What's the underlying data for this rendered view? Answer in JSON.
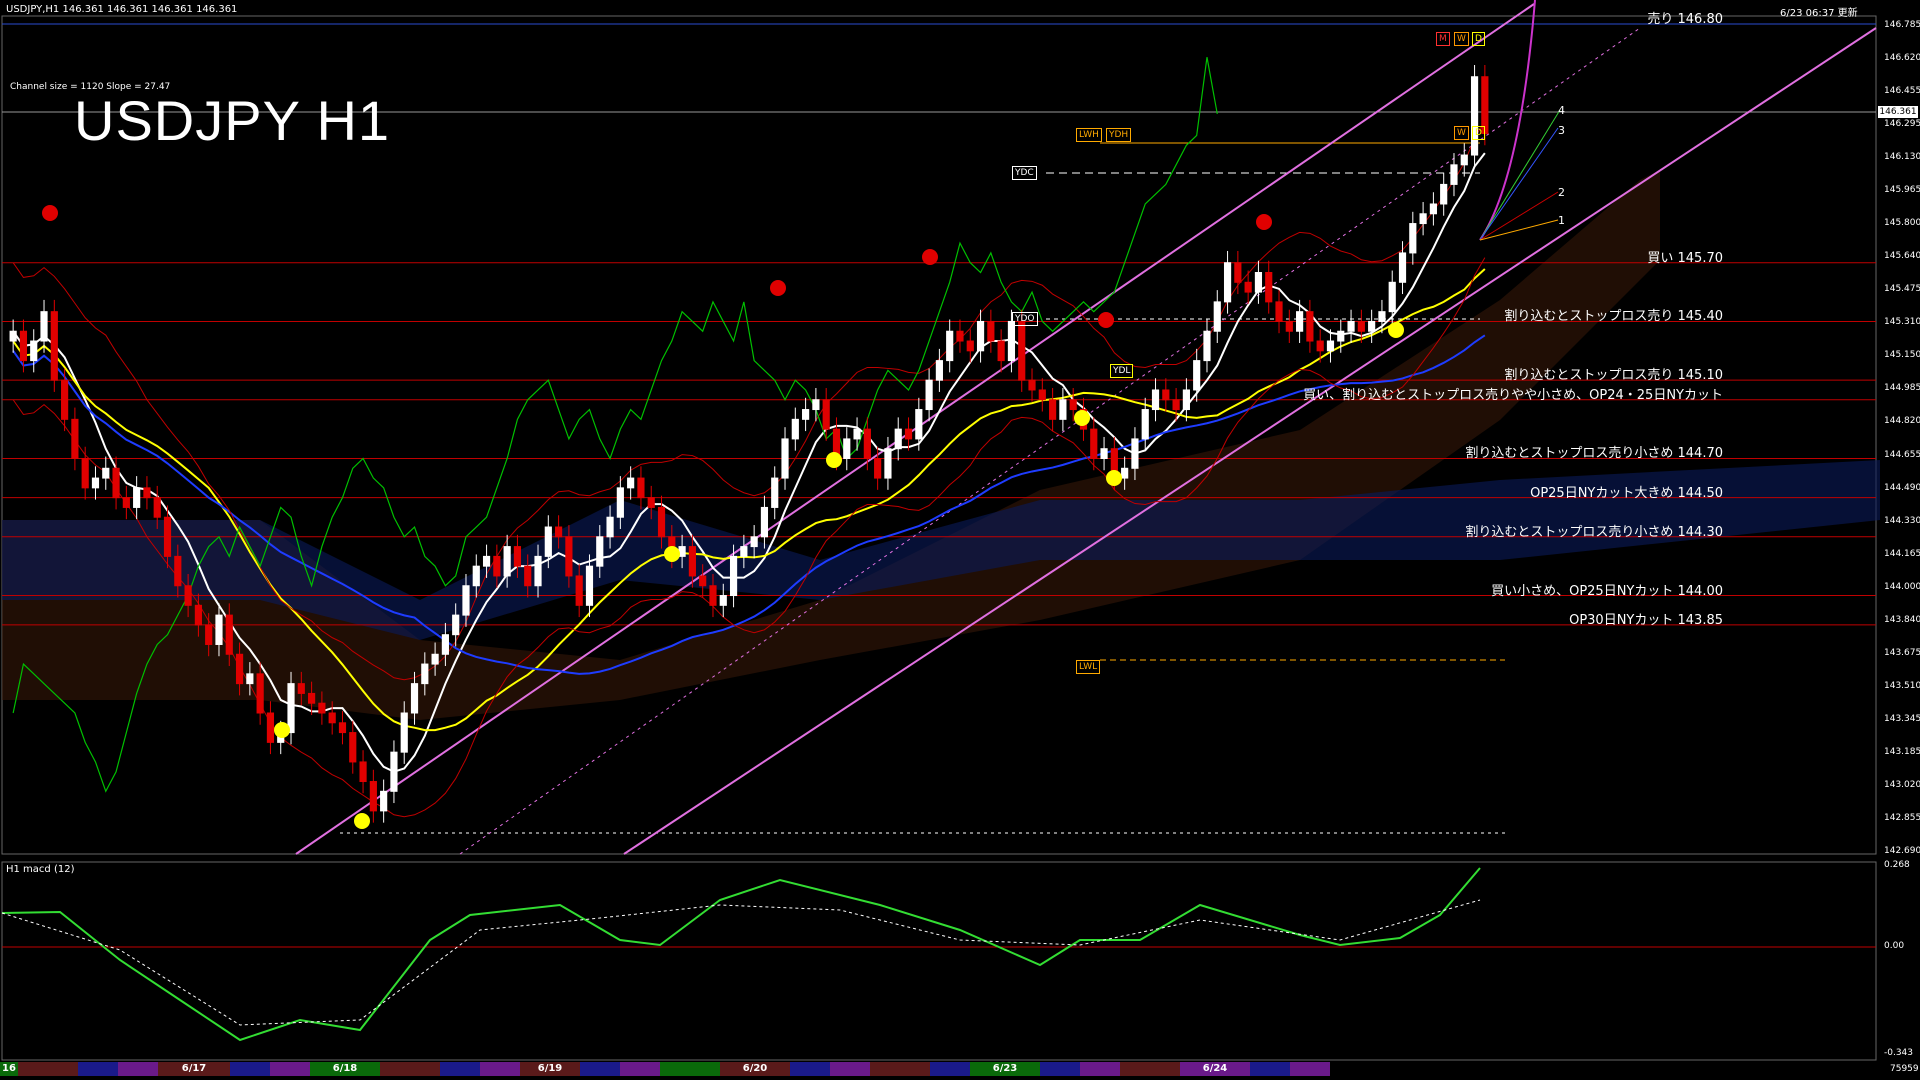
{
  "header": {
    "symbol_line": "USDJPY,H1  146.361 146.361 146.361 146.361",
    "datetime": "6/23 06:37 更新",
    "channel_info": "Channel size = 1120 Slope = 27.47",
    "big_title": "USDJPY H1"
  },
  "sub_chart": {
    "label": "H1  macd (12)",
    "axis": [
      "0.268",
      "0.00",
      "-0.343"
    ],
    "bottom_right": "75959"
  },
  "current_price": "146.361",
  "price_axis": [
    "146.785",
    "146.620",
    "146.455",
    "146.295",
    "146.130",
    "145.965",
    "145.800",
    "145.640",
    "145.475",
    "145.310",
    "145.150",
    "144.985",
    "144.820",
    "144.655",
    "144.490",
    "144.330",
    "144.165",
    "144.000",
    "143.840",
    "143.675",
    "143.510",
    "143.345",
    "143.185",
    "143.020",
    "142.855",
    "142.690"
  ],
  "levels": [
    {
      "price": 146.8,
      "label": "売り 146.80",
      "color": "#2a4cd0"
    },
    {
      "price": 145.7,
      "label": "買い 145.70",
      "color": "#c00000"
    },
    {
      "price": 145.4,
      "label": "割り込むとストップロス売り 145.40",
      "color": "#c00000"
    },
    {
      "price": 145.1,
      "label": "割り込むとストップロス売り 145.10",
      "color": "#c00000"
    },
    {
      "price": 145.0,
      "label": "買い、割り込むとストップロス売りやや小さめ、OP24・25日NYカット",
      "color": "#c00000"
    },
    {
      "price": 144.7,
      "label": "割り込むとストップロス売り小さめ 144.70",
      "color": "#c00000"
    },
    {
      "price": 144.5,
      "label": "OP25日NYカット大きめ 144.50",
      "color": "#c00000"
    },
    {
      "price": 144.3,
      "label": "割り込むとストップロス売り小さめ 144.30",
      "color": "#c00000"
    },
    {
      "price": 144.0,
      "label": "買い小さめ、OP25日NYカット 144.00",
      "color": "#c00000"
    },
    {
      "price": 143.85,
      "label": "OP30日NYカット 143.85",
      "color": "#c00000"
    }
  ],
  "tags": {
    "lwh": "LWH",
    "ydh": "YDH",
    "ydc": "YDC",
    "ydo": "YDO",
    "ydl": "YDL",
    "lwl": "LWL",
    "m": "M",
    "w": "W",
    "d": "D",
    "w2": "W",
    "d2": "D"
  },
  "fork_labels": [
    "4",
    "3",
    "2",
    "1"
  ],
  "dates": [
    "16",
    "6/17",
    "6/18",
    "6/19",
    "6/20",
    "6/23",
    "6/24"
  ],
  "colors": {
    "bull": "#ffffff",
    "bear": "#e00000",
    "ma_white": "#ffffff",
    "ma_yellow": "#ffff00",
    "ma_blue": "#1e3cff",
    "chikou": "#00c000",
    "channel": "#e070e0",
    "bollinger": "#c00000",
    "macd": "#33dd33",
    "macd_neg": "#ff7090",
    "grid_red": "#c00000"
  },
  "chart_data": {
    "type": "candlestick",
    "title": "USDJPY H1",
    "ylim": [
      142.69,
      146.95
    ],
    "close": [
      145.35,
      145.2,
      145.3,
      145.45,
      145.1,
      144.9,
      144.7,
      144.55,
      144.6,
      144.65,
      144.5,
      144.45,
      144.55,
      144.5,
      144.4,
      144.2,
      144.05,
      143.95,
      143.85,
      143.75,
      143.9,
      143.7,
      143.55,
      143.6,
      143.4,
      143.25,
      143.3,
      143.55,
      143.5,
      143.45,
      143.4,
      143.35,
      143.3,
      143.15,
      143.05,
      142.9,
      143.0,
      143.2,
      143.4,
      143.55,
      143.65,
      143.7,
      143.8,
      143.9,
      144.05,
      144.15,
      144.2,
      144.1,
      144.25,
      144.15,
      144.05,
      144.2,
      144.35,
      144.3,
      144.1,
      143.95,
      144.15,
      144.3,
      144.4,
      144.55,
      144.6,
      144.5,
      144.45,
      144.3,
      144.2,
      144.25,
      144.1,
      144.05,
      143.95,
      144.0,
      144.2,
      144.25,
      144.3,
      144.45,
      144.6,
      144.8,
      144.9,
      144.95,
      145.0,
      144.85,
      144.7,
      144.8,
      144.85,
      144.7,
      144.6,
      144.75,
      144.85,
      144.8,
      144.95,
      145.1,
      145.2,
      145.35,
      145.3,
      145.25,
      145.4,
      145.3,
      145.2,
      145.4,
      145.1,
      145.05,
      145.0,
      144.9,
      145.0,
      144.95,
      144.85,
      144.7,
      144.75,
      144.6,
      144.65,
      144.8,
      144.95,
      145.05,
      145.0,
      144.95,
      145.05,
      145.2,
      145.35,
      145.5,
      145.7,
      145.6,
      145.55,
      145.65,
      145.5,
      145.4,
      145.35,
      145.45,
      145.3,
      145.25,
      145.3,
      145.35,
      145.4,
      145.35,
      145.4,
      145.45,
      145.6,
      145.75,
      145.9,
      145.95,
      146.0,
      146.1,
      146.2,
      146.25,
      146.65,
      146.36
    ],
    "open": [
      145.3,
      145.35,
      145.2,
      145.3,
      145.45,
      145.1,
      144.9,
      144.7,
      144.55,
      144.6,
      144.65,
      144.5,
      144.45,
      144.55,
      144.5,
      144.4,
      144.2,
      144.05,
      143.95,
      143.85,
      143.75,
      143.9,
      143.7,
      143.55,
      143.6,
      143.4,
      143.25,
      143.3,
      143.55,
      143.5,
      143.45,
      143.4,
      143.35,
      143.3,
      143.15,
      143.05,
      142.9,
      143.0,
      143.2,
      143.4,
      143.55,
      143.65,
      143.7,
      143.8,
      143.9,
      144.05,
      144.15,
      144.2,
      144.1,
      144.25,
      144.15,
      144.05,
      144.2,
      144.35,
      144.3,
      144.1,
      143.95,
      144.15,
      144.3,
      144.4,
      144.55,
      144.6,
      144.5,
      144.45,
      144.3,
      144.2,
      144.25,
      144.1,
      144.05,
      143.95,
      144.0,
      144.2,
      144.25,
      144.3,
      144.45,
      144.6,
      144.8,
      144.9,
      144.95,
      145.0,
      144.85,
      144.7,
      144.8,
      144.85,
      144.7,
      144.6,
      144.75,
      144.85,
      144.8,
      144.95,
      145.1,
      145.2,
      145.35,
      145.3,
      145.25,
      145.4,
      145.3,
      145.2,
      145.4,
      145.1,
      145.05,
      145.0,
      144.9,
      145.0,
      144.95,
      144.85,
      144.7,
      144.75,
      144.6,
      144.65,
      144.8,
      144.95,
      145.05,
      145.0,
      144.95,
      145.05,
      145.2,
      145.35,
      145.5,
      145.7,
      145.6,
      145.55,
      145.65,
      145.5,
      145.4,
      145.35,
      145.45,
      145.3,
      145.25,
      145.3,
      145.35,
      145.4,
      145.35,
      145.4,
      145.45,
      145.6,
      145.75,
      145.9,
      145.95,
      146.0,
      146.1,
      146.2,
      146.25,
      146.65
    ]
  }
}
